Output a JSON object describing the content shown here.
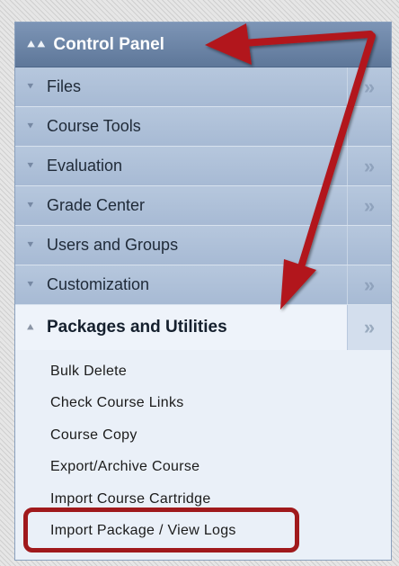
{
  "panel": {
    "title": "Control Panel",
    "title_icon": "double-chevron-up-icon",
    "sections": [
      {
        "label": "Files",
        "expand_arrow": "»"
      },
      {
        "label": "Course Tools",
        "expand_arrow": ""
      },
      {
        "label": "Evaluation",
        "expand_arrow": "»"
      },
      {
        "label": "Grade Center",
        "expand_arrow": "»"
      },
      {
        "label": "Users and Groups",
        "expand_arrow": ""
      },
      {
        "label": "Customization",
        "expand_arrow": "»"
      }
    ],
    "open_section": {
      "label": "Packages and Utilities",
      "expand_arrow": "»",
      "items": [
        "Bulk Delete",
        "Check Course Links",
        "Course Copy",
        "Export/Archive Course",
        "Import Course Cartridge",
        "Import Package / View Logs"
      ]
    }
  },
  "annotation": {
    "highlighted_item": "Import Package / View Logs",
    "arrow_color": "#b2161b"
  }
}
